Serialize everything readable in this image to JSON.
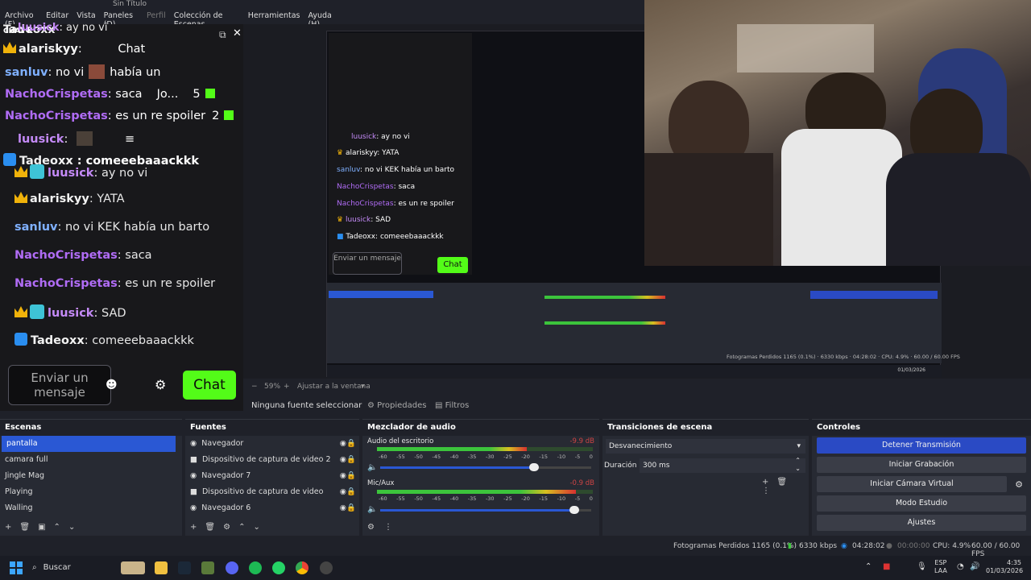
{
  "window": {
    "title": "Sin Título"
  },
  "menu": [
    "Archivo (F)",
    "Editar",
    "Vista",
    "Paneles (D)",
    "Perfil",
    "Colección de Escenas",
    "Herramientas",
    "Ayuda (H)"
  ],
  "chat": {
    "top_user": "Tadeoxx",
    "header_partial": "CHAT K",
    "overlay_lines": [
      {
        "user": "luusick",
        "text": "ay no vi"
      },
      {
        "user": "alariskyy",
        "text": "Chat"
      },
      {
        "user": "sanluv",
        "text": "no vi",
        "text2": "había un"
      },
      {
        "user": "NachoCrispetas",
        "text": "saca",
        "text2": "Jo...",
        "extra": "5"
      },
      {
        "user": "NachoCrispetas",
        "text": "es un re spoiler",
        "extra": "2"
      },
      {
        "user": "luusick",
        "text": ""
      },
      {
        "user": "Tadeoxx",
        "text": "comeeebaaackkk"
      }
    ],
    "messages": [
      {
        "user": "luusick",
        "text": "ay no vi",
        "user_color": "#c48af7"
      },
      {
        "user": "alariskyy",
        "text": "YATA",
        "user_color": "#f2f2f2"
      },
      {
        "user": "sanluv",
        "text": "no vi KEK había un barto",
        "user_color": "#7fb0ff"
      },
      {
        "user": "NachoCrispetas",
        "text": "saca",
        "user_color": "#b06cf5"
      },
      {
        "user": "NachoCrispetas",
        "text": "es un re spoiler",
        "user_color": "#b06cf5"
      },
      {
        "user": "luusick",
        "text": "SAD",
        "user_color": "#c48af7"
      },
      {
        "user": "Tadeoxx",
        "text": "comeeebaaackkk",
        "user_color": "#f2f2f2"
      }
    ],
    "input_placeholder": "Enviar un mensaje",
    "send_label": "Chat",
    "accent": "#53fc18"
  },
  "preview": {
    "zoom": "59%",
    "fit_label": "Ajustar a la ventana",
    "no_source": "Ninguna fuente seleccionar",
    "properties_label": "Propiedades",
    "filters_label": "Filtros"
  },
  "nested": {
    "chat_messages": [
      {
        "user": "luusick",
        "text": "ay no vi"
      },
      {
        "user": "alariskyy",
        "text": "YATA"
      },
      {
        "user": "sanluv",
        "text": "no vi KEK había un barto"
      },
      {
        "user": "NachoCrispetas",
        "text": "saca"
      },
      {
        "user": "NachoCrispetas",
        "text": "es un re spoiler"
      },
      {
        "user": "luusick",
        "text": "SAD"
      },
      {
        "user": "Tadeoxx",
        "text": "comeeebaaackkk"
      }
    ],
    "input_placeholder": "Enviar un mensaje",
    "send_label": "Chat",
    "status": "Fotogramas Perdidos 1165 (0.1%)",
    "kbps": "6330 kbps",
    "time": "04:28:02",
    "cpu": "CPU: 4.9%",
    "fps": "60.00 / 60.00 FPS",
    "date": "01/03/2026"
  },
  "docks": {
    "scenes": {
      "title": "Escenas",
      "items": [
        "pantalla",
        "camara full",
        "Jingle Mag",
        "Playing",
        "Walling"
      ]
    },
    "sources": {
      "title": "Fuentes",
      "items": [
        "Navegador",
        "Dispositivo de captura de video 2",
        "Navegador 7",
        "Dispositivo de captura de video",
        "Navegador 6"
      ]
    },
    "mixer": {
      "title": "Mezclador de audio",
      "channels": [
        {
          "name": "Audio del escritorio",
          "db": "-9.9 dB",
          "level": 0.7,
          "volume": 0.73
        },
        {
          "name": "Mic/Aux",
          "db": "-0.9 dB",
          "level": 0.93,
          "volume": 0.92
        }
      ],
      "scale": [
        "-60",
        "-55",
        "-50",
        "-45",
        "-40",
        "-35",
        "-30",
        "-25",
        "-20",
        "-15",
        "-10",
        "-5",
        "0"
      ]
    },
    "transitions": {
      "title": "Transiciones de escena",
      "selected": "Desvanecimiento",
      "duration_label": "Duración",
      "duration_value": "300 ms"
    },
    "controls": {
      "title": "Controles",
      "buttons": [
        "Detener Transmisión",
        "Iniciar Grabación",
        "Iniciar Cámara Virtual",
        "Modo Estudio",
        "Ajustes"
      ]
    }
  },
  "status": {
    "dropped": "Fotogramas Perdidos 1165 (0.1%)",
    "kbps": "6330 kbps",
    "stream_time": "04:28:02",
    "rec_time": "00:00:00",
    "cpu": "CPU: 4.9%",
    "fps": "60.00 / 60.00 FPS"
  },
  "taskbar": {
    "search": "Buscar",
    "lang": "ESP",
    "lang2": "LAA",
    "time": "4:35",
    "date": "01/03/2026"
  },
  "colors": {
    "obs_blue": "#2a58d4",
    "kick_green": "#53fc18",
    "meter_green": "#3cc43c",
    "meter_yellow": "#d8c020",
    "meter_red": "#d83030"
  }
}
